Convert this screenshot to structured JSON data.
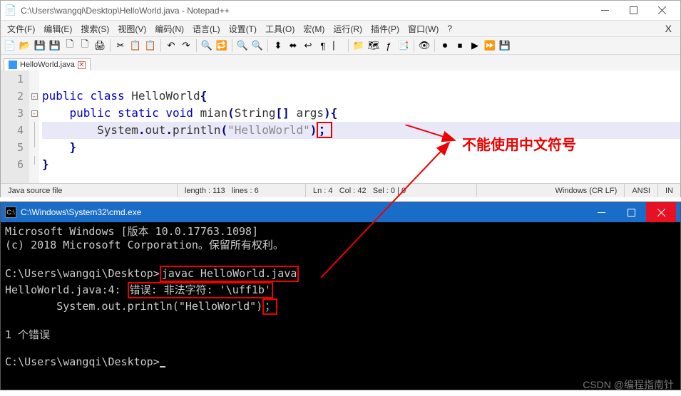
{
  "npp": {
    "title": "C:\\Users\\wangqi\\Desktop\\HelloWorld.java - Notepad++",
    "menus": [
      "文件(F)",
      "编辑(E)",
      "搜索(S)",
      "视图(V)",
      "编码(N)",
      "语言(L)",
      "设置(T)",
      "工具(O)",
      "宏(M)",
      "运行(R)",
      "插件(P)",
      "窗口(W)",
      "?"
    ],
    "tab": {
      "name": "HelloWorld.java"
    },
    "lines": {
      "l1": "",
      "l2_kw1": "public",
      "l2_kw2": "class",
      "l2_cls": "HelloWorld",
      "l3_kw1": "public",
      "l3_kw2": "static",
      "l3_kw3": "void",
      "l3_fn": "mian",
      "l3_type": "String",
      "l3_arr": "[]",
      "l3_arg": "args",
      "l4_obj": "System",
      "l4_m1": "out",
      "l4_m2": "println",
      "l4_str": "\"HelloWorld\"",
      "l4_semi": "；",
      "l5": "}",
      "l6": "}"
    },
    "status": {
      "type": "Java source file",
      "len": "length : 113",
      "lines": "lines : 6",
      "ln": "Ln : 4",
      "col": "Col : 42",
      "sel": "Sel : 0 | 0",
      "eol": "Windows (CR LF)",
      "enc": "ANSI",
      "ins": "IN"
    }
  },
  "cmd": {
    "title": "C:\\Windows\\System32\\cmd.exe",
    "l1": "Microsoft Windows [版本 10.0.17763.1098]",
    "l2": "(c) 2018 Microsoft Corporation。保留所有权利。",
    "l3a": "C:\\Users\\wangqi\\Desktop>",
    "l3b": "javac HelloWorld.java",
    "l4a": "HelloWorld.java:4: ",
    "l4b": "错误: 非法字符: '\\uff1b'",
    "l5a": "        System.out.println(\"HelloWorld\")",
    "l5b": "；",
    "l6": "1 个错误",
    "l7": "C:\\Users\\wangqi\\Desktop>"
  },
  "annotation": "不能使用中文符号",
  "watermark": "CSDN @编程指南针"
}
